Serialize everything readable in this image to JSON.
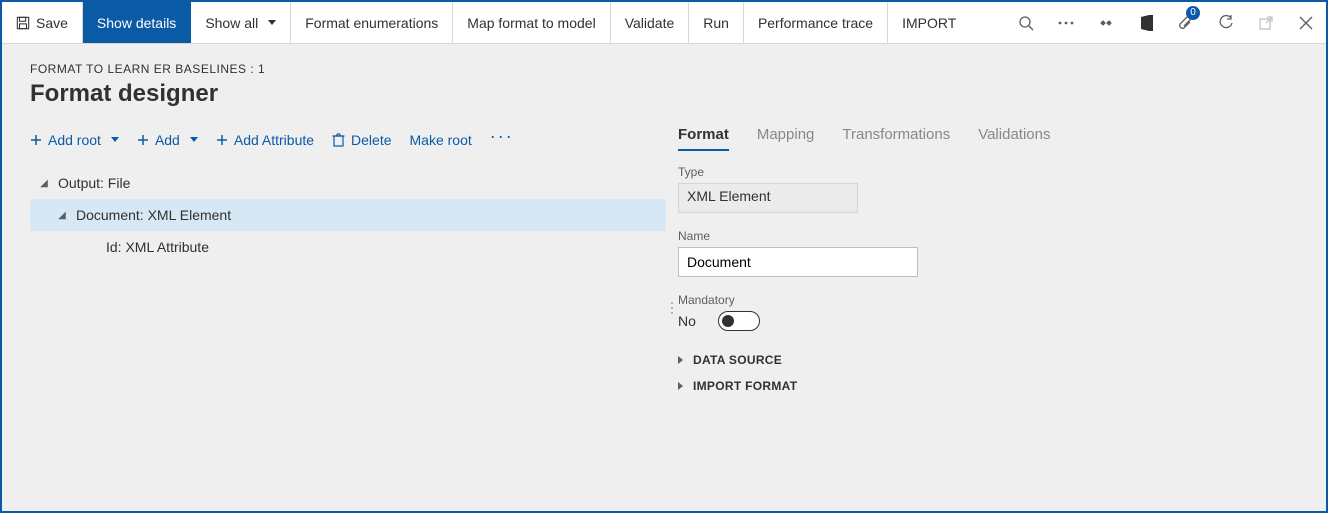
{
  "commandbar": {
    "save": "Save",
    "show_details": "Show details",
    "show_all": "Show all",
    "format_enum": "Format enumerations",
    "map_format": "Map format to model",
    "validate": "Validate",
    "run": "Run",
    "perf_trace": "Performance trace",
    "import": "IMPORT",
    "badge_count": "0"
  },
  "header": {
    "breadcrumb": "FORMAT TO LEARN ER BASELINES : 1",
    "title": "Format designer"
  },
  "toolbar": {
    "add_root": "Add root",
    "add": "Add",
    "add_attribute": "Add Attribute",
    "delete": "Delete",
    "make_root": "Make root"
  },
  "tree": {
    "node0": "Output: File",
    "node1": "Document: XML Element",
    "node2": "Id: XML Attribute"
  },
  "right": {
    "tabs": {
      "format": "Format",
      "mapping": "Mapping",
      "transformations": "Transformations",
      "validations": "Validations"
    },
    "type_label": "Type",
    "type_value": "XML Element",
    "name_label": "Name",
    "name_value": "Document",
    "mandatory_label": "Mandatory",
    "mandatory_value": "No",
    "expander_ds": "DATA SOURCE",
    "expander_if": "IMPORT FORMAT"
  }
}
